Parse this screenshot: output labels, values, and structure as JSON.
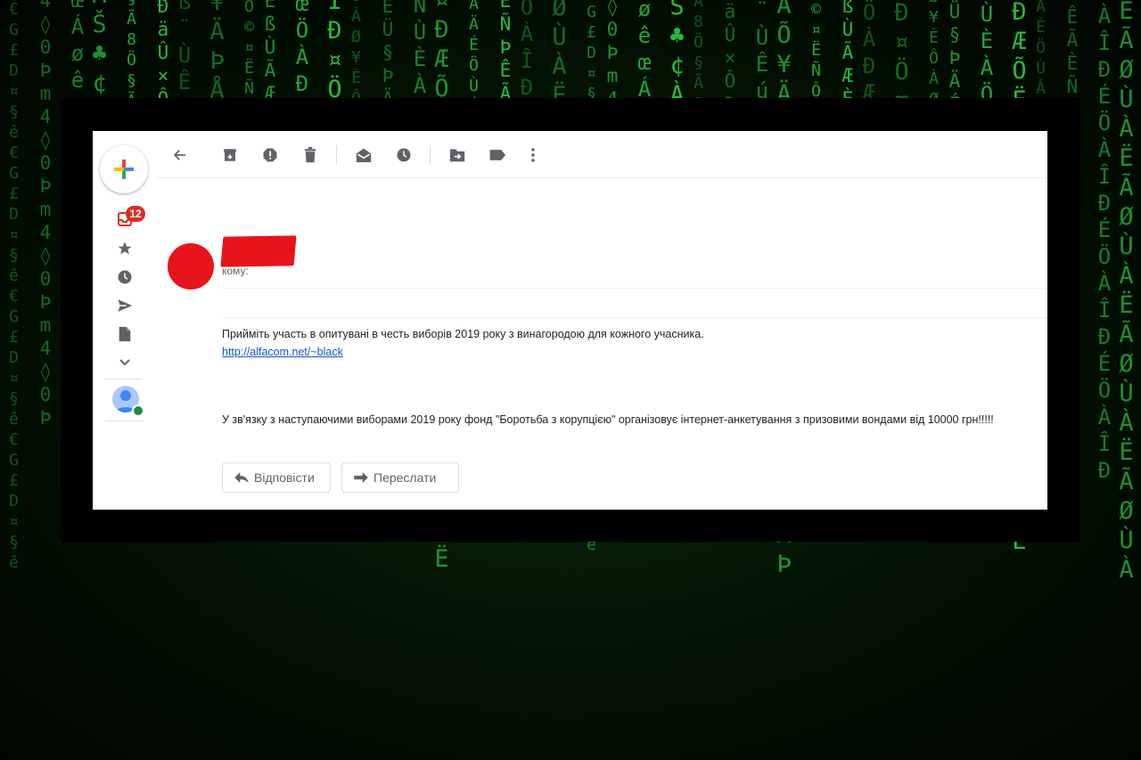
{
  "background": {
    "columns": [
      "€G£D¤§ê",
      "m4◊0Þ",
      "øêœÁ",
      "ÀŠ♣¢",
      "8Ö§Ã",
      "ÐäÛ×Ô",
      "úß¨ÙÊ",
      "ÅÕ¥ÄÞ",
      "ÑÔ©¤Ë",
      "ÃÆÈßÙ",
      "œÖÀÐÆ",
      "æÎÐ¤Ö",
      "Ø¥ÈÔÀ",
      "ÄÉÜ§Þ",
      "ÀÖÑÙÈ",
      "¤ÐÆÕË",
      "ÖÙÁÄÉ",
      "ÞÊÃÈÑ",
      "ÉÖÀÎÐ",
      "ËÃØÙÀ"
    ]
  },
  "nav": {
    "inbox_badge": "12",
    "items": [
      "compose-icon",
      "inbox-icon",
      "star-icon",
      "clock-icon",
      "send-icon",
      "draft-icon",
      "chevron-down-icon"
    ]
  },
  "toolbar": {
    "icons": [
      "back-icon",
      "archive-icon",
      "report-spam-icon",
      "delete-icon",
      "mark-unread-icon",
      "snooze-icon",
      "move-to-icon",
      "label-icon",
      "more-icon"
    ]
  },
  "message": {
    "to_label": "кому:",
    "line1": "Прийміть участь в опитувані в честь виборів 2019 року з винагородою для кожного учасника.",
    "link": "http://alfacom.net/~black",
    "line2": "У зв'язку з наступаючими виборами 2019 року фонд \"Боротьба з корупцією\" організовує інтернет-анкетування з призовими вондами від 10000 грн!!!!!"
  },
  "actions": {
    "reply": "Відповісти",
    "forward": "Переслати"
  }
}
